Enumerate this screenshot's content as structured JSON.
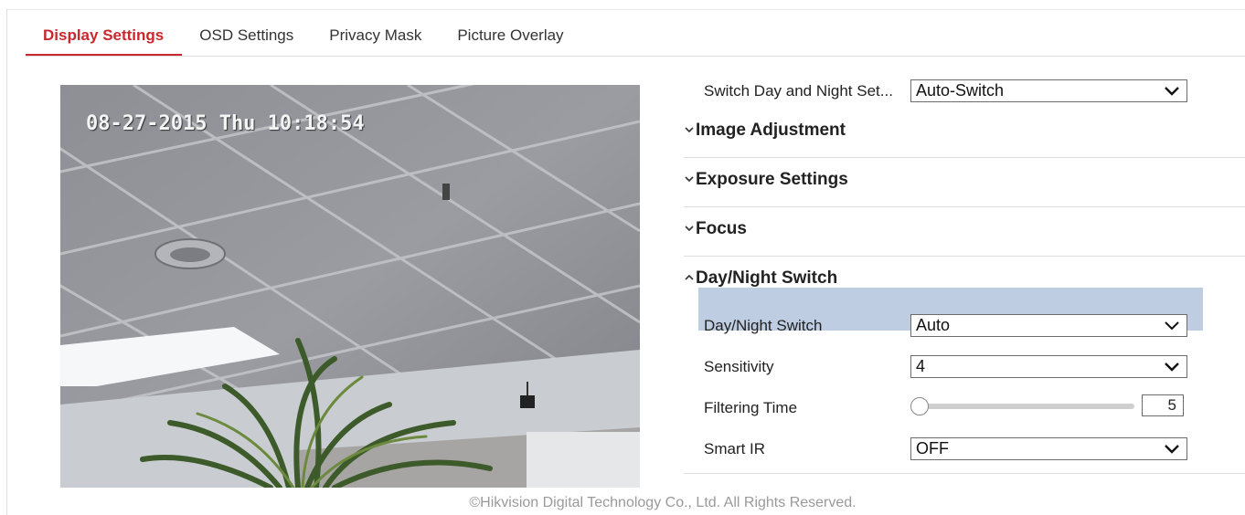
{
  "tabs": [
    {
      "label": "Display Settings",
      "active": true
    },
    {
      "label": "OSD Settings",
      "active": false
    },
    {
      "label": "Privacy Mask",
      "active": false
    },
    {
      "label": "Picture Overlay",
      "active": false
    }
  ],
  "live_view": {
    "osd_time": "08-27-2015 Thu 10:18:54"
  },
  "settings": {
    "switch_day_night": {
      "label": "Switch Day and Night Set...",
      "value": "Auto-Switch"
    },
    "sections": {
      "image_adjustment": "Image Adjustment",
      "exposure_settings": "Exposure Settings",
      "focus": "Focus",
      "day_night_switch": "Day/Night Switch"
    },
    "day_night": {
      "mode_label": "Day/Night Switch",
      "mode_value": "Auto",
      "sensitivity_label": "Sensitivity",
      "sensitivity_value": "4",
      "filtering_label": "Filtering Time",
      "filtering_value": "5",
      "smart_ir_label": "Smart IR",
      "smart_ir_value": "OFF"
    }
  },
  "footer": "©Hikvision Digital Technology Co., Ltd. All Rights Reserved.",
  "colors": {
    "accent": "#c8282d",
    "highlight": "#b9c9df"
  }
}
